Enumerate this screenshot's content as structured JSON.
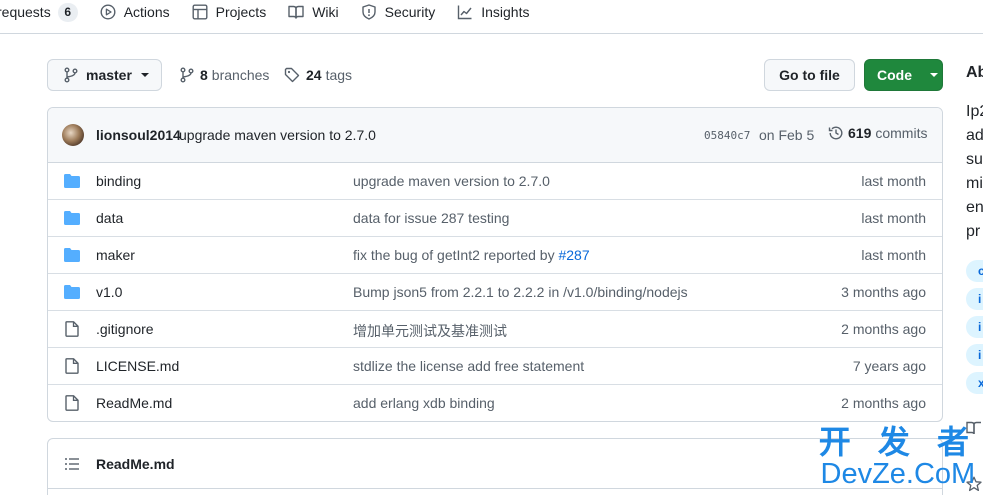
{
  "nav": {
    "tabs": [
      {
        "label": "requests",
        "count": "6"
      },
      {
        "label": "Actions"
      },
      {
        "label": "Projects"
      },
      {
        "label": "Wiki"
      },
      {
        "label": "Security"
      },
      {
        "label": "Insights"
      }
    ]
  },
  "toolbar": {
    "branch": "master",
    "branches_count": "8",
    "branches_label": "branches",
    "tags_count": "24",
    "tags_label": "tags",
    "goto_label": "Go to file",
    "code_label": "Code"
  },
  "commit": {
    "author": "lionsoul2014",
    "message": "upgrade maven version to 2.7.0",
    "sha": "05840c7",
    "date": "on Feb 5",
    "count": "619",
    "count_label": "commits"
  },
  "files": [
    {
      "type": "folder",
      "name": "binding",
      "message": "upgrade maven version to 2.7.0",
      "age": "last month"
    },
    {
      "type": "folder",
      "name": "data",
      "message": "data for issue 287 testing",
      "age": "last month"
    },
    {
      "type": "folder",
      "name": "maker",
      "message": "fix the bug of getInt2 reported by ",
      "link": "#287",
      "age": "last month"
    },
    {
      "type": "folder",
      "name": "v1.0",
      "message": "Bump json5 from 2.2.1 to 2.2.2 in /v1.0/binding/nodejs",
      "age": "3 months ago"
    },
    {
      "type": "file",
      "name": ".gitignore",
      "message": "增加单元测试及基准测试",
      "age": "2 months ago"
    },
    {
      "type": "file",
      "name": "LICENSE.md",
      "message": "stdlize the license add free statement",
      "age": "7 years ago"
    },
    {
      "type": "file",
      "name": "ReadMe.md",
      "message": "add erlang xdb binding",
      "age": "2 months ago"
    }
  ],
  "readme": {
    "title": "ReadMe.md"
  },
  "sidebar": {
    "about": "Ab",
    "desc_lines": [
      "Ip2",
      "ad",
      "su",
      "mi",
      "en",
      "pr"
    ],
    "topics": [
      "c",
      "i",
      "i",
      "i",
      "x"
    ]
  },
  "watermark": {
    "line1": "开 发 者",
    "line2": "DevZe.CoM"
  },
  "colors": {
    "accent": "#0969da",
    "folder": "#54aeff",
    "code_button": "#1f883d",
    "watermark": "#1e88e5"
  }
}
